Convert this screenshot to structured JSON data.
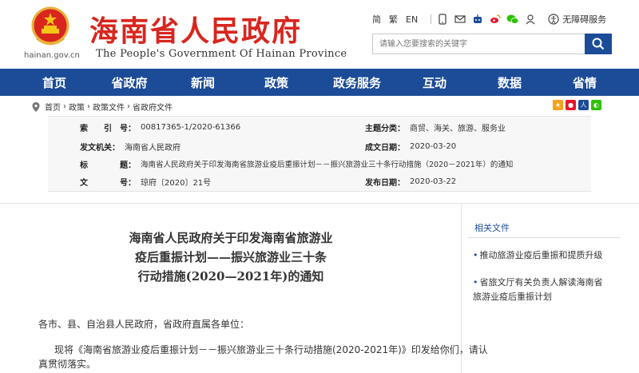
{
  "header": {
    "domain": "hainan.gov.cn",
    "site_name_cn": "海南省人民政府",
    "site_name_en": "The People's Government Of Hainan Province",
    "lang_simplified": "简",
    "lang_traditional": "繁",
    "lang_en": "EN",
    "accessibility_label": "无障碍服务",
    "search_placeholder": "请输入您要搜索的关键字",
    "brand_red": "#d8261f",
    "brand_blue": "#1c4c98"
  },
  "nav": {
    "items": [
      "首页",
      "省政府",
      "新闻",
      "政策",
      "政务服务",
      "互动",
      "数据",
      "省情"
    ]
  },
  "breadcrumb": {
    "items": [
      "首页",
      "政策",
      "政策文件",
      "省政府文件"
    ]
  },
  "meta": {
    "index_label": "索　　引　号：",
    "index_value": "00817365-1/2020-61366",
    "topic_label": "主题分类：",
    "topic_value": "商贸、海关、旅游、服务业",
    "issuer_label": "发文机关：",
    "issuer_value": "海南省人民政府",
    "created_label": "成文日期：",
    "created_value": "2020-03-20",
    "title_label": "标　　　　题：",
    "title_value": "海南省人民政府关于印发海南省旅游业疫后重振计划－－振兴旅游业三十条行动措施（2020－2021年）的通知",
    "docno_label": "文　　　　号：",
    "docno_value": "琼府〔2020〕21号",
    "published_label": "发布日期：",
    "published_value": "2020-03-22"
  },
  "article": {
    "title_lines": [
      "海南省人民政府关于印发海南省旅游业",
      "疫后重振计划——振兴旅游业三十条",
      "行动措施(2020—2021年)的通知"
    ],
    "salutation": "各市、县、自治县人民政府，省政府直属各单位：",
    "body_line1": "现将《海南省旅游业疫后重振计划－－振兴旅游业三十条行动措施(2020-2021年)》印发给你们，请认",
    "body_line2": "真贯彻落实。"
  },
  "sidebar": {
    "heading": "相关文件",
    "items": [
      "推动旅游业疫后重振和提质升级",
      "省旅文厅有关负责人解读海南省旅游业疫后重振计划"
    ]
  }
}
